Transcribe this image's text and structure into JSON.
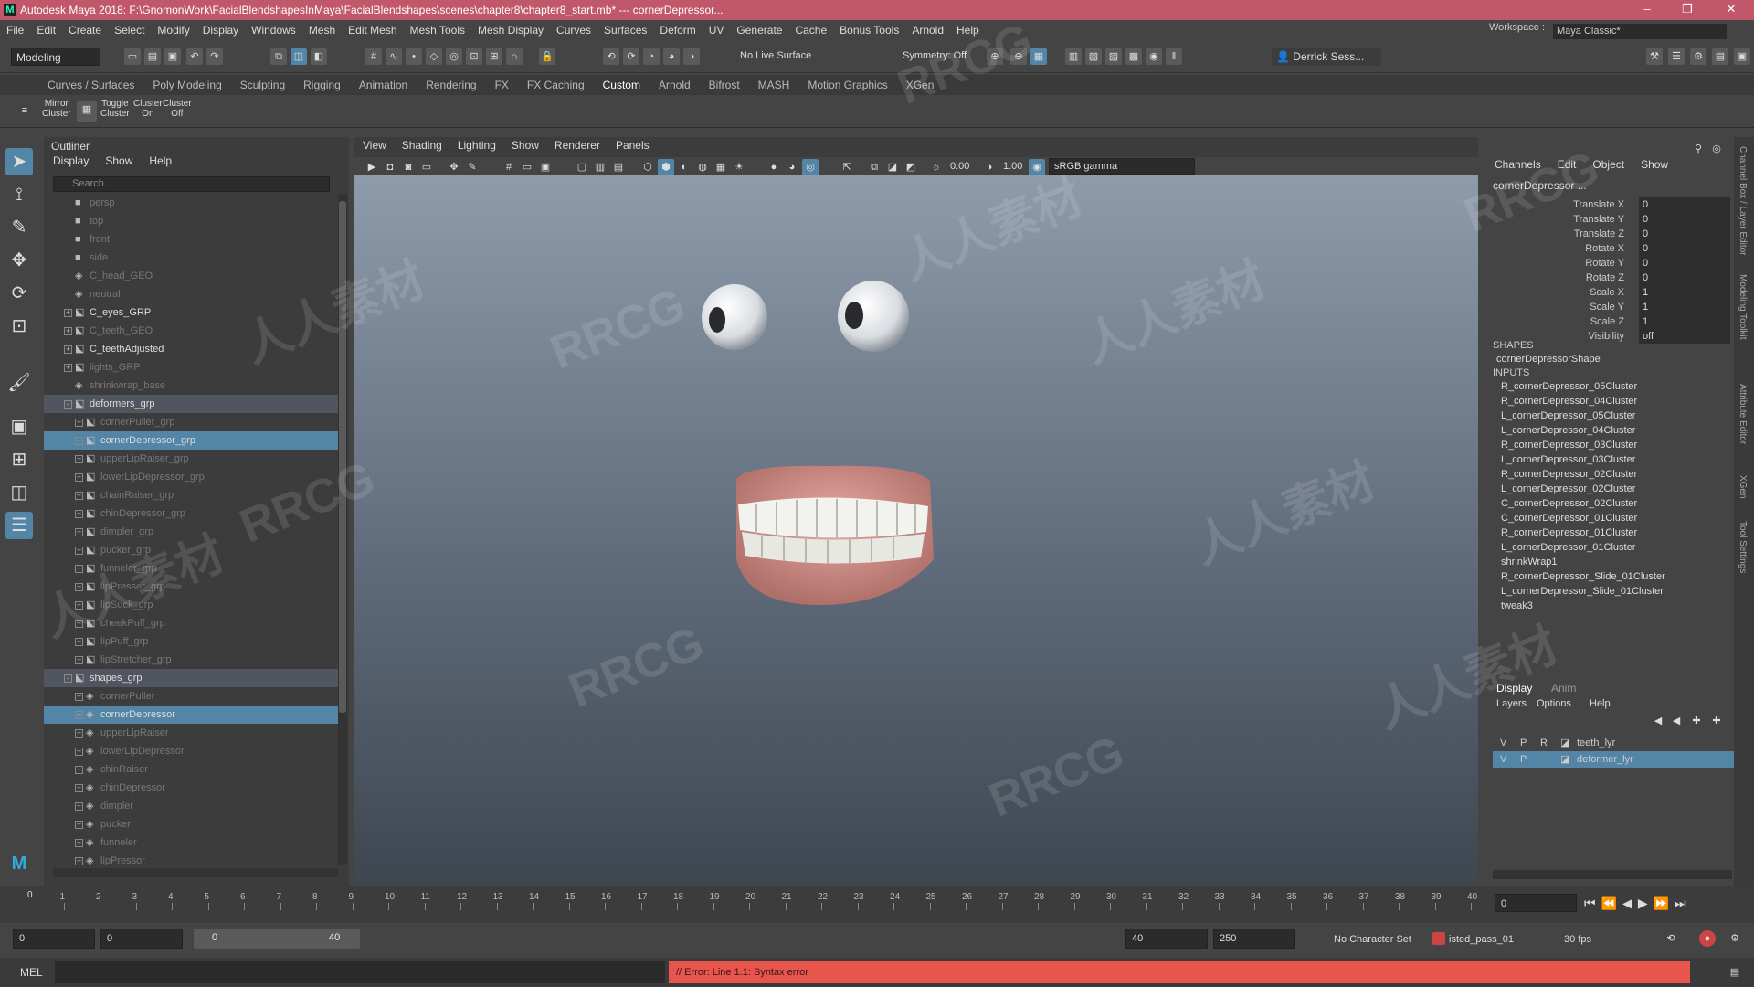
{
  "window": {
    "title": "Autodesk Maya 2018: F:\\GnomonWork\\FacialBlendshapesInMaya\\FacialBlendshapes\\scenes\\chapter8\\chapter8_start.mb*   ---   cornerDepressor..."
  },
  "menubar": [
    "File",
    "Edit",
    "Create",
    "Select",
    "Modify",
    "Display",
    "Windows",
    "Mesh",
    "Edit Mesh",
    "Mesh Tools",
    "Mesh Display",
    "Curves",
    "Surfaces",
    "Deform",
    "UV",
    "Generate",
    "Cache",
    "Bonus Tools",
    "Arnold",
    "Help"
  ],
  "workspace": {
    "label": "Workspace :",
    "value": "Maya Classic*"
  },
  "statusline": {
    "mode": "Modeling",
    "live_surface": "No Live Surface",
    "symmetry": "Symmetry: Off",
    "user": "Derrick Sess..."
  },
  "shelf_tabs": [
    "Curves / Surfaces",
    "Poly Modeling",
    "Sculpting",
    "Rigging",
    "Animation",
    "Rendering",
    "FX",
    "FX Caching",
    "Custom",
    "Arnold",
    "Bifrost",
    "MASH",
    "Motion Graphics",
    "XGen"
  ],
  "shelf_active": "Custom",
  "shelf_buttons": [
    {
      "label": "Mirror\nCluster"
    },
    {
      "label": "Toggle\nCluster"
    },
    {
      "label": "Cluster\nOn"
    },
    {
      "label": "Cluster\nOff"
    }
  ],
  "outliner": {
    "title": "Outliner",
    "menu": [
      "Display",
      "Show",
      "Help"
    ],
    "search_placeholder": "Search...",
    "items": [
      {
        "label": "persp",
        "icon": "camera-icon",
        "depth": 0,
        "state": "dim"
      },
      {
        "label": "top",
        "icon": "camera-icon",
        "depth": 0,
        "state": "dim"
      },
      {
        "label": "front",
        "icon": "camera-icon",
        "depth": 0,
        "state": "dim"
      },
      {
        "label": "side",
        "icon": "camera-icon",
        "depth": 0,
        "state": "dim"
      },
      {
        "label": "C_head_GEO",
        "icon": "transform-icon",
        "depth": 0,
        "state": "dim"
      },
      {
        "label": "neutral",
        "icon": "transform-icon",
        "depth": 0,
        "state": "dim"
      },
      {
        "label": "C_eyes_GRP",
        "icon": "group-icon",
        "depth": 0,
        "state": "",
        "exp": "+"
      },
      {
        "label": "C_teeth_GEO",
        "icon": "group-icon",
        "depth": 0,
        "state": "dim",
        "exp": "+"
      },
      {
        "label": "C_teethAdjusted",
        "icon": "group-icon",
        "depth": 0,
        "state": "",
        "exp": "+"
      },
      {
        "label": "lights_GRP",
        "icon": "group-icon",
        "depth": 0,
        "state": "dim",
        "exp": "+"
      },
      {
        "label": "shrinkwrap_base",
        "icon": "transform-icon",
        "depth": 0,
        "state": "dim"
      },
      {
        "label": "deformers_grp",
        "icon": "group-icon",
        "depth": 0,
        "state": "hl",
        "exp": "-"
      },
      {
        "label": "cornerPuller_grp",
        "icon": "group-icon",
        "depth": 1,
        "state": "dim",
        "exp": "+"
      },
      {
        "label": "cornerDepressor_grp",
        "icon": "group-icon",
        "depth": 1,
        "state": "sel",
        "exp": "+"
      },
      {
        "label": "upperLipRaiser_grp",
        "icon": "group-icon",
        "depth": 1,
        "state": "dim",
        "exp": "+"
      },
      {
        "label": "lowerLipDepressor_grp",
        "icon": "group-icon",
        "depth": 1,
        "state": "dim",
        "exp": "+"
      },
      {
        "label": "chainRaiser_grp",
        "icon": "group-icon",
        "depth": 1,
        "state": "dim",
        "exp": "+"
      },
      {
        "label": "chinDepressor_grp",
        "icon": "group-icon",
        "depth": 1,
        "state": "dim",
        "exp": "+"
      },
      {
        "label": "dimpler_grp",
        "icon": "group-icon",
        "depth": 1,
        "state": "dim",
        "exp": "+"
      },
      {
        "label": "pucker_grp",
        "icon": "group-icon",
        "depth": 1,
        "state": "dim",
        "exp": "+"
      },
      {
        "label": "funneler_grp",
        "icon": "group-icon",
        "depth": 1,
        "state": "dim",
        "exp": "+"
      },
      {
        "label": "lipPresser_grp",
        "icon": "group-icon",
        "depth": 1,
        "state": "dim",
        "exp": "+"
      },
      {
        "label": "lipSuck_grp",
        "icon": "group-icon",
        "depth": 1,
        "state": "dim",
        "exp": "+"
      },
      {
        "label": "cheekPuff_grp",
        "icon": "group-icon",
        "depth": 1,
        "state": "dim",
        "exp": "+"
      },
      {
        "label": "lipPuff_grp",
        "icon": "group-icon",
        "depth": 1,
        "state": "dim",
        "exp": "+"
      },
      {
        "label": "lipStretcher_grp",
        "icon": "group-icon",
        "depth": 1,
        "state": "dim",
        "exp": "+"
      },
      {
        "label": "shapes_grp",
        "icon": "group-icon",
        "depth": 0,
        "state": "hl",
        "exp": "-"
      },
      {
        "label": "cornerPuller",
        "icon": "transform-icon",
        "depth": 1,
        "state": "dim",
        "exp": "+"
      },
      {
        "label": "cornerDepressor",
        "icon": "transform-icon",
        "depth": 1,
        "state": "sel",
        "exp": "+"
      },
      {
        "label": "upperLipRaiser",
        "icon": "transform-icon",
        "depth": 1,
        "state": "dim",
        "exp": "+"
      },
      {
        "label": "lowerLipDepressor",
        "icon": "transform-icon",
        "depth": 1,
        "state": "dim",
        "exp": "+"
      },
      {
        "label": "chinRaiser",
        "icon": "transform-icon",
        "depth": 1,
        "state": "dim",
        "exp": "+"
      },
      {
        "label": "chinDepressor",
        "icon": "transform-icon",
        "depth": 1,
        "state": "dim",
        "exp": "+"
      },
      {
        "label": "dimpler",
        "icon": "transform-icon",
        "depth": 1,
        "state": "dim",
        "exp": "+"
      },
      {
        "label": "pucker",
        "icon": "transform-icon",
        "depth": 1,
        "state": "dim",
        "exp": "+"
      },
      {
        "label": "funneler",
        "icon": "transform-icon",
        "depth": 1,
        "state": "dim",
        "exp": "+"
      },
      {
        "label": "lipPressor",
        "icon": "transform-icon",
        "depth": 1,
        "state": "dim",
        "exp": "+"
      }
    ]
  },
  "viewport": {
    "menu": [
      "View",
      "Shading",
      "Lighting",
      "Show",
      "Renderer",
      "Panels"
    ],
    "exposure": "0.00",
    "gamma": "1.00",
    "color_space": "sRGB gamma"
  },
  "channelbox": {
    "menu": [
      "Channels",
      "Edit",
      "Object",
      "Show"
    ],
    "object": "cornerDepressor ...",
    "attrs": [
      {
        "name": "Translate X",
        "value": "0"
      },
      {
        "name": "Translate Y",
        "value": "0"
      },
      {
        "name": "Translate Z",
        "value": "0"
      },
      {
        "name": "Rotate X",
        "value": "0"
      },
      {
        "name": "Rotate Y",
        "value": "0"
      },
      {
        "name": "Rotate Z",
        "value": "0"
      },
      {
        "name": "Scale X",
        "value": "1"
      },
      {
        "name": "Scale Y",
        "value": "1"
      },
      {
        "name": "Scale Z",
        "value": "1"
      },
      {
        "name": "Visibility",
        "value": "off"
      }
    ],
    "shapes_label": "SHAPES",
    "shape": "cornerDepressorShape",
    "inputs_label": "INPUTS",
    "inputs": [
      "R_cornerDepressor_05Cluster",
      "R_cornerDepressor_04Cluster",
      "L_cornerDepressor_05Cluster",
      "L_cornerDepressor_04Cluster",
      "R_cornerDepressor_03Cluster",
      "L_cornerDepressor_03Cluster",
      "R_cornerDepressor_02Cluster",
      "L_cornerDepressor_02Cluster",
      "C_cornerDepressor_02Cluster",
      "C_cornerDepressor_01Cluster",
      "R_cornerDepressor_01Cluster",
      "L_cornerDepressor_01Cluster",
      "shrinkWrap1",
      "R_cornerDepressor_Slide_01Cluster",
      "L_cornerDepressor_Slide_01Cluster",
      "tweak3"
    ]
  },
  "layers": {
    "tabs": [
      "Display",
      "Anim"
    ],
    "menu": [
      "Layers",
      "Options",
      "Help"
    ],
    "columns": [
      "V",
      "P",
      "R"
    ],
    "rows": [
      {
        "v": "",
        "p": "",
        "name": "teeth_lyr",
        "selected": false
      },
      {
        "v": "V",
        "p": "P",
        "name": "deformer_lyr",
        "selected": true
      }
    ]
  },
  "right_strip": [
    "Channel Box / Layer Editor",
    "Modeling Toolkit",
    "Attribute Editor",
    "XGen",
    "Tool Settings"
  ],
  "timeslider": {
    "ticks": [
      "1",
      "2",
      "3",
      "4",
      "5",
      "6",
      "7",
      "8",
      "9",
      "10",
      "11",
      "12",
      "13",
      "14",
      "15",
      "16",
      "17",
      "18",
      "19",
      "20",
      "21",
      "22",
      "23",
      "24",
      "25",
      "26",
      "27",
      "28",
      "29",
      "30",
      "31",
      "32",
      "33",
      "34",
      "35",
      "36",
      "37",
      "38",
      "39",
      "40"
    ],
    "current_frame": "0",
    "frame_field": "0"
  },
  "range": {
    "start": "0",
    "playback_start": "0",
    "inner_start": "0",
    "inner_end": "40",
    "playback_end": "40",
    "end": "250",
    "character_set": "No Character Set",
    "anim_layer": "isted_pass_01",
    "fps": "30 fps"
  },
  "cmdline": {
    "label": "MEL",
    "error": "// Error: Line 1.1: Syntax error"
  },
  "watermarks": [
    "RRCG",
    "人人素材",
    "RRCG",
    "人人素材",
    "RRCG",
    "人人素材",
    "RRCG",
    "人人素材",
    "RRCG",
    "人人素材",
    "RRCG",
    "人人素材"
  ]
}
